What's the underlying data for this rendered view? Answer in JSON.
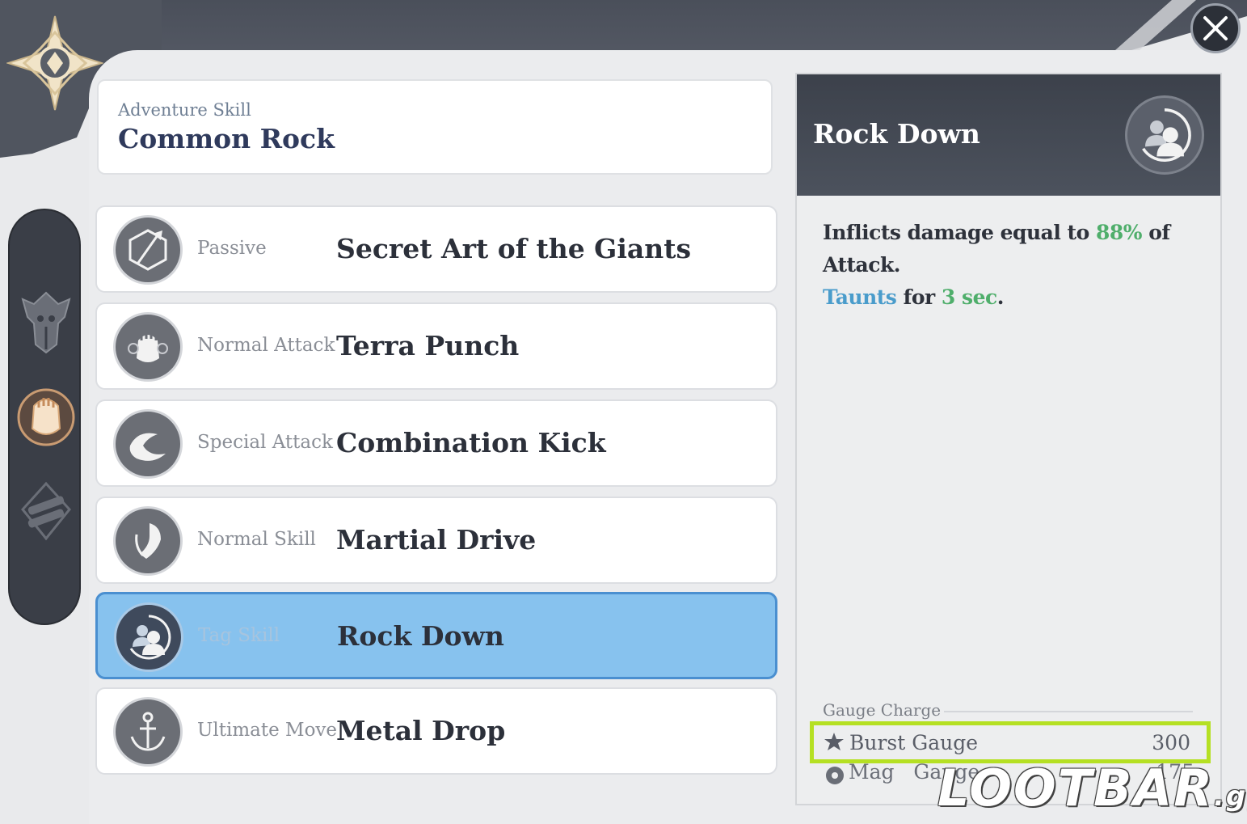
{
  "header": {
    "label": "Adventure Skill",
    "title": "Common Rock"
  },
  "skills": [
    {
      "type": "Passive",
      "name": "Secret Art of the Giants",
      "icon": "hexagon-pick-icon",
      "selected": false
    },
    {
      "type": "Normal Attack",
      "name": "Terra Punch",
      "icon": "fist-icon",
      "selected": false
    },
    {
      "type": "Special Attack",
      "name": "Combination Kick",
      "icon": "kick-swirl-icon",
      "selected": false
    },
    {
      "type": "Normal Skill",
      "name": "Martial Drive",
      "icon": "martial-figure-icon",
      "selected": false
    },
    {
      "type": "Tag Skill",
      "name": "Rock Down",
      "icon": "tag-swap-icon",
      "selected": true
    },
    {
      "type": "Ultimate Move",
      "name": "Metal Drop",
      "icon": "anchor-drop-icon",
      "selected": false
    }
  ],
  "detail": {
    "title": "Rock Down",
    "description": {
      "p1": "Inflicts damage equal to ",
      "pct": "88%",
      "p2": " of Attack.",
      "taunt": "Taunts",
      "p3": " for ",
      "dur": "3 sec",
      "p4": "."
    },
    "gauge_title": "Gauge Charge",
    "burst_label": "Burst Gauge",
    "burst_value": "300",
    "mag_label": "Mag",
    "mag_label2": "Gauge",
    "mag_value": "175"
  },
  "watermark": {
    "brand": "LOOTBAR",
    "tld": ".gg"
  },
  "colors": {
    "accent_green": "#4fae6b",
    "accent_blue": "#4a9ccb",
    "selected_row": "#87c2ee",
    "highlight_box": "#b5e023"
  }
}
